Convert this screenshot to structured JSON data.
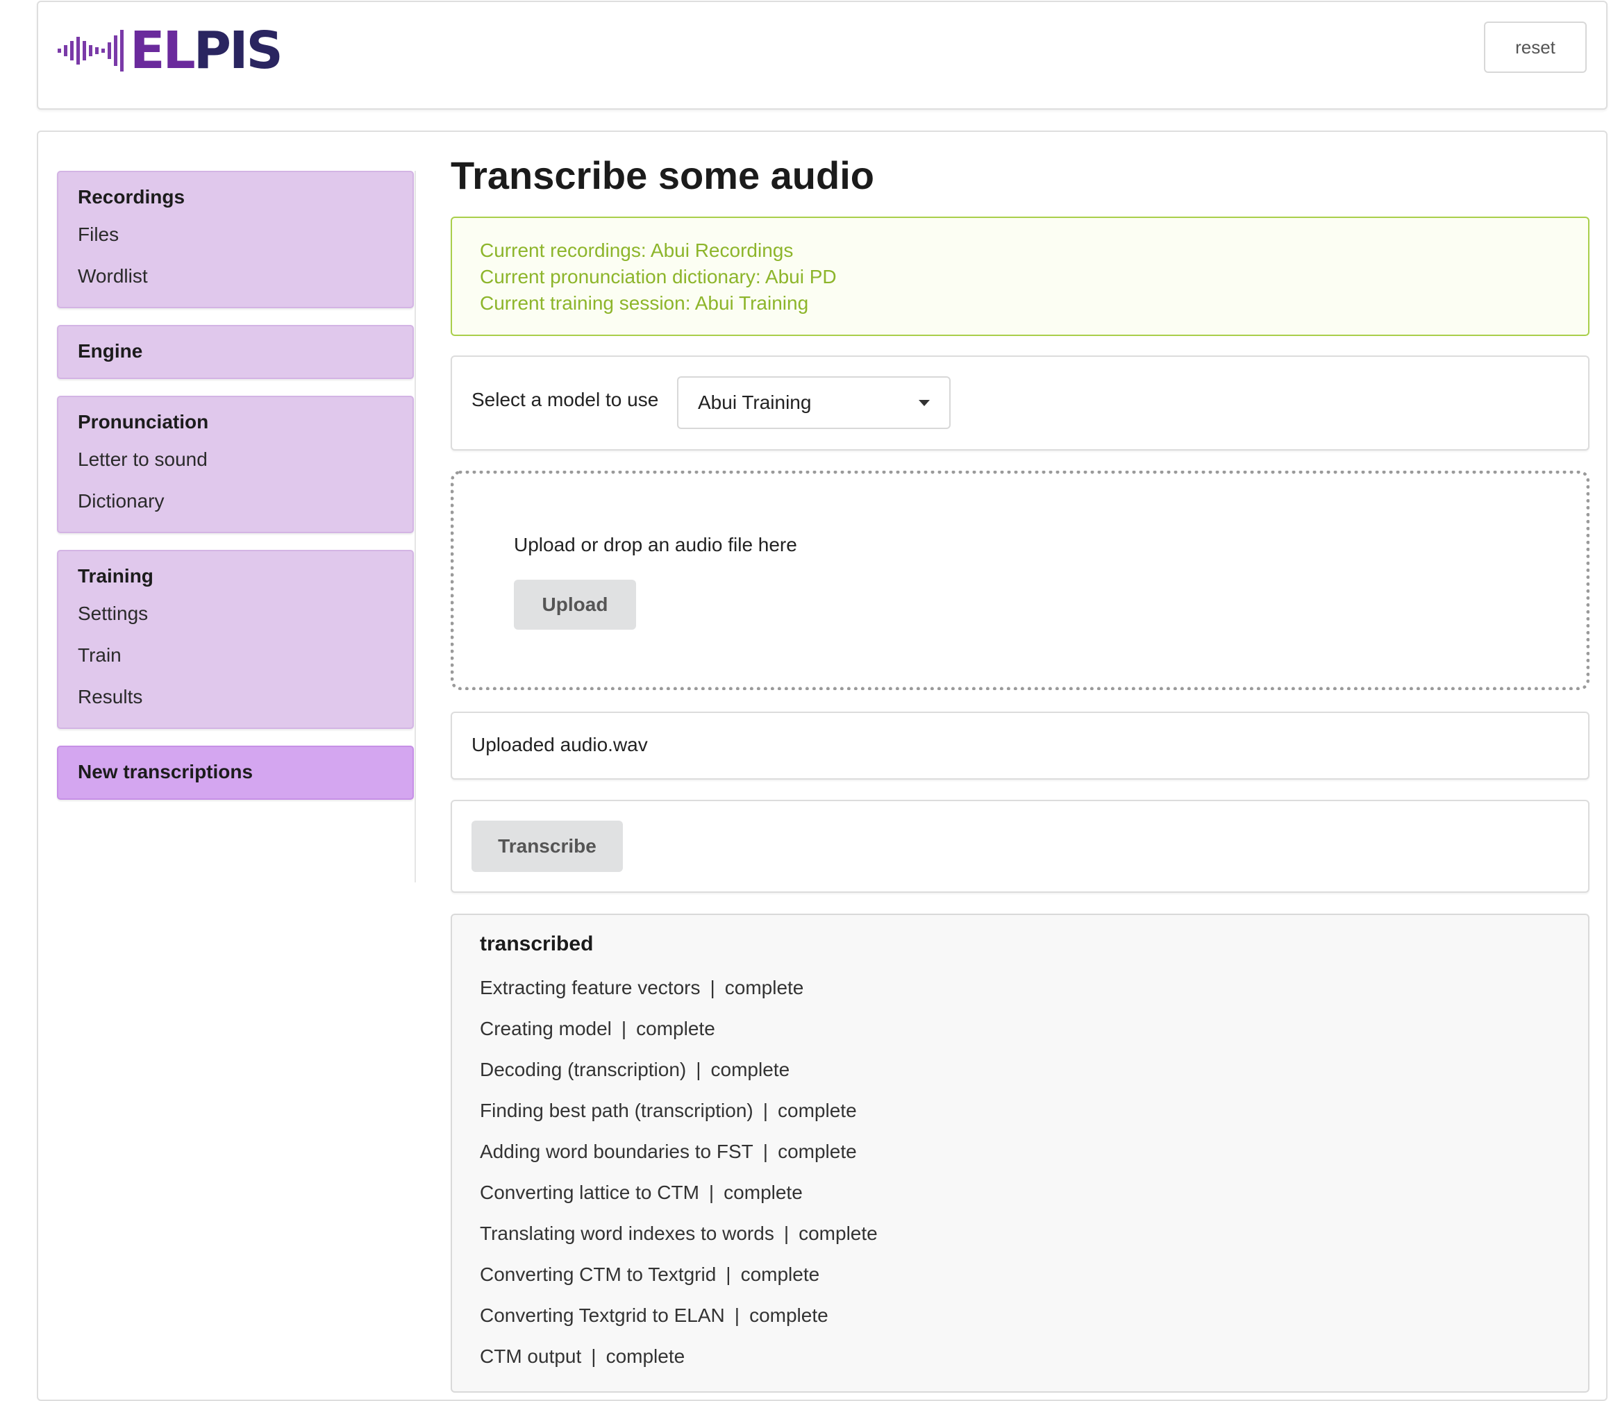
{
  "header": {
    "logo_text_el": "EL",
    "logo_text_pis": "PIS",
    "reset_label": "reset"
  },
  "sidebar": {
    "groups": [
      {
        "heading": "Recordings",
        "items": [
          "Files",
          "Wordlist"
        ]
      },
      {
        "heading": "Engine",
        "items": []
      },
      {
        "heading": "Pronunciation",
        "items": [
          "Letter to sound",
          "Dictionary"
        ]
      },
      {
        "heading": "Training",
        "items": [
          "Settings",
          "Train",
          "Results"
        ]
      },
      {
        "heading": "New transcriptions",
        "items": []
      }
    ]
  },
  "main": {
    "title": "Transcribe some audio",
    "info": {
      "recordings": "Current recordings: Abui Recordings",
      "pronunciation": "Current pronunciation dictionary: Abui PD",
      "training": "Current training session: Abui Training"
    },
    "model": {
      "label": "Select a model to use",
      "selected": "Abui Training"
    },
    "upload": {
      "prompt": "Upload or drop an audio file here",
      "button": "Upload"
    },
    "uploaded_file": "Uploaded audio.wav",
    "transcribe_button": "Transcribe",
    "status": {
      "title": "transcribed",
      "separator": "|",
      "rows": [
        {
          "step": "Extracting feature vectors",
          "state": "complete"
        },
        {
          "step": "Creating model",
          "state": "complete"
        },
        {
          "step": "Decoding (transcription)",
          "state": "complete"
        },
        {
          "step": "Finding best path (transcription)",
          "state": "complete"
        },
        {
          "step": "Adding word boundaries to FST",
          "state": "complete"
        },
        {
          "step": "Converting lattice to CTM",
          "state": "complete"
        },
        {
          "step": "Translating word indexes to words",
          "state": "complete"
        },
        {
          "step": "Converting CTM to Textgrid",
          "state": "complete"
        },
        {
          "step": "Converting Textgrid to ELAN",
          "state": "complete"
        },
        {
          "step": "CTM output",
          "state": "complete"
        }
      ]
    }
  },
  "colors": {
    "nav_bg": "#e0c8ec",
    "nav_active_bg": "#d4a6f0",
    "info_text": "#8db52b",
    "info_border": "#a9cf4a",
    "logo_purple": "#6a2a9c",
    "logo_navy": "#2a2560"
  }
}
